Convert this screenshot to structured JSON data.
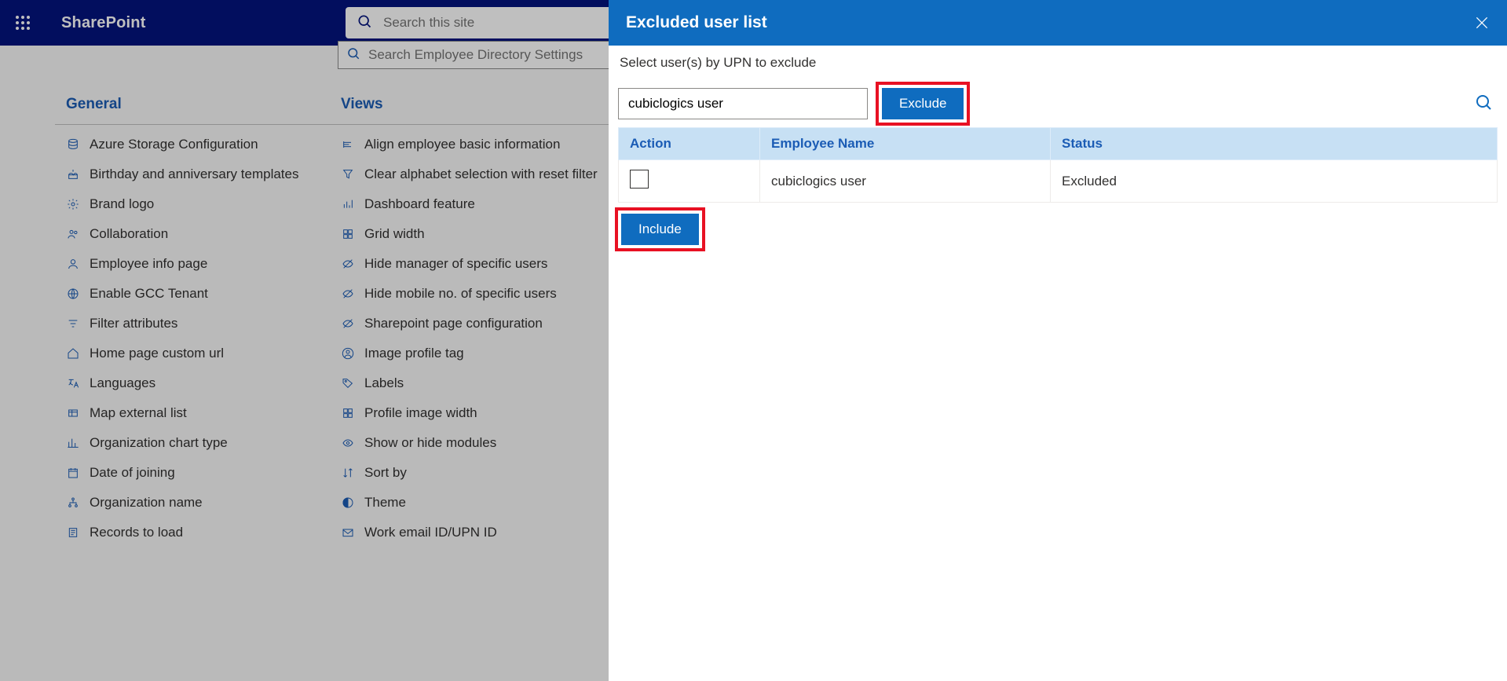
{
  "suite": {
    "brand": "SharePoint",
    "search_placeholder": "Search this site"
  },
  "settings_search": {
    "placeholder": "Search Employee Directory Settings"
  },
  "columns": {
    "general": {
      "title": "General",
      "items": [
        {
          "icon": "database",
          "label": "Azure Storage Configuration"
        },
        {
          "icon": "cake",
          "label": "Birthday and anniversary templates"
        },
        {
          "icon": "gear",
          "label": "Brand logo"
        },
        {
          "icon": "people",
          "label": "Collaboration"
        },
        {
          "icon": "person",
          "label": "Employee info page"
        },
        {
          "icon": "globe",
          "label": "Enable GCC Tenant"
        },
        {
          "icon": "filter",
          "label": "Filter attributes"
        },
        {
          "icon": "home",
          "label": "Home page custom url"
        },
        {
          "icon": "language",
          "label": "Languages"
        },
        {
          "icon": "map",
          "label": "Map external list"
        },
        {
          "icon": "chart",
          "label": "Organization chart type"
        },
        {
          "icon": "calendar",
          "label": "Date of joining"
        },
        {
          "icon": "org-tree",
          "label": "Organization name"
        },
        {
          "icon": "records",
          "label": "Records to load"
        }
      ]
    },
    "views": {
      "title": "Views",
      "items": [
        {
          "icon": "align",
          "label": "Align employee basic information"
        },
        {
          "icon": "funnel",
          "label": "Clear alphabet selection with reset filter"
        },
        {
          "icon": "dashboard",
          "label": "Dashboard feature"
        },
        {
          "icon": "grid",
          "label": "Grid width"
        },
        {
          "icon": "hide",
          "label": "Hide manager of specific users"
        },
        {
          "icon": "hide",
          "label": "Hide mobile no. of specific users"
        },
        {
          "icon": "hide",
          "label": "Sharepoint page configuration"
        },
        {
          "icon": "profile",
          "label": "Image profile tag"
        },
        {
          "icon": "tag",
          "label": "Labels"
        },
        {
          "icon": "grid",
          "label": "Profile image width"
        },
        {
          "icon": "eye",
          "label": "Show or hide modules"
        },
        {
          "icon": "sort",
          "label": "Sort by"
        },
        {
          "icon": "theme",
          "label": "Theme"
        },
        {
          "icon": "mail",
          "label": "Work email ID/UPN ID"
        }
      ]
    }
  },
  "panel": {
    "title": "Excluded user list",
    "instruction": "Select user(s) by UPN to exclude",
    "upn_value": "cubiclogics user",
    "exclude_label": "Exclude",
    "include_label": "Include",
    "headers": {
      "action": "Action",
      "name": "Employee Name",
      "status": "Status"
    },
    "rows": [
      {
        "name": "cubiclogics user",
        "status": "Excluded"
      }
    ]
  }
}
